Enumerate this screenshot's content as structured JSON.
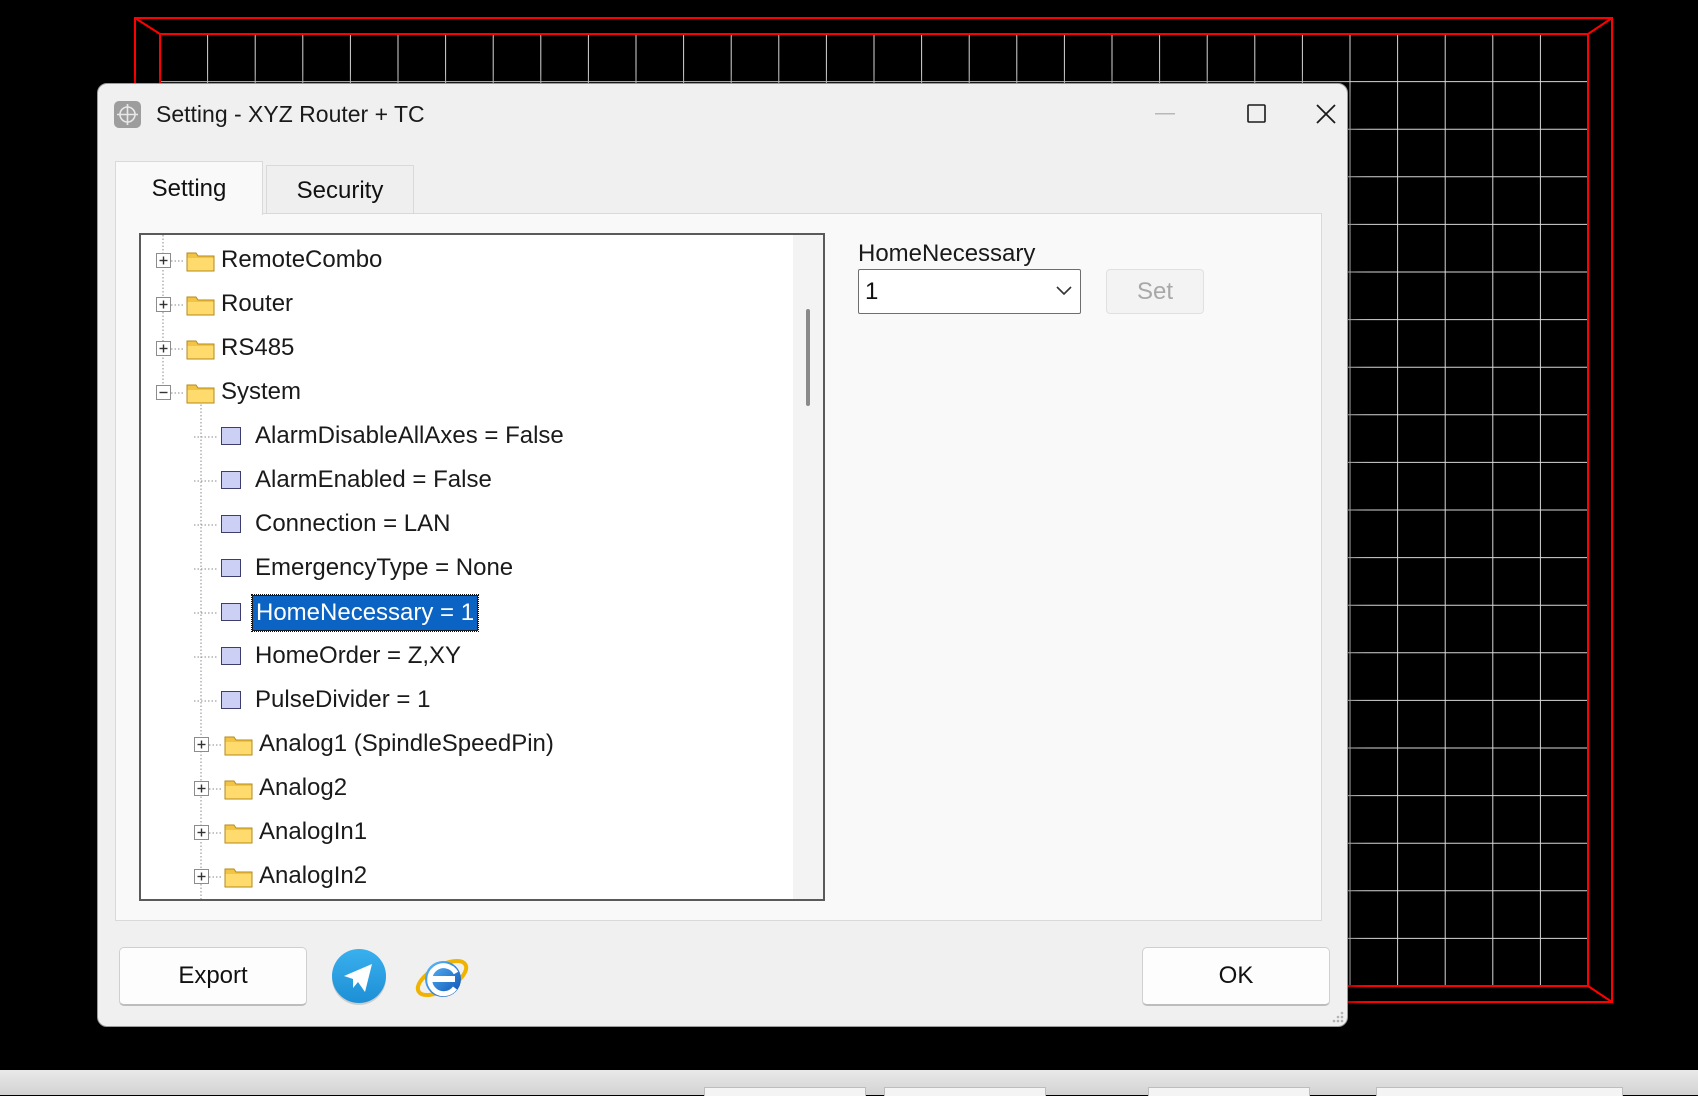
{
  "window": {
    "title": "Setting - XYZ Router + TC"
  },
  "tabs": [
    {
      "label": "Setting",
      "active": true
    },
    {
      "label": "Security",
      "active": false
    }
  ],
  "tree": {
    "nodes": [
      {
        "label": "RemoteCombo",
        "type": "folder",
        "expander": "plus"
      },
      {
        "label": "Router",
        "type": "folder",
        "expander": "plus"
      },
      {
        "label": "RS485",
        "type": "folder",
        "expander": "plus"
      },
      {
        "label": "System",
        "type": "folder",
        "expander": "minus"
      },
      {
        "label": "AlarmDisableAllAxes = False",
        "type": "leaf"
      },
      {
        "label": "AlarmEnabled = False",
        "type": "leaf"
      },
      {
        "label": "Connection = LAN",
        "type": "leaf"
      },
      {
        "label": "EmergencyType = None",
        "type": "leaf"
      },
      {
        "label": "HomeNecessary = 1",
        "type": "leaf",
        "selected": true
      },
      {
        "label": "HomeOrder = Z,XY",
        "type": "leaf"
      },
      {
        "label": "PulseDivider = 1",
        "type": "leaf"
      },
      {
        "label": "Analog1 (SpindleSpeedPin)",
        "type": "folder",
        "expander": "plus"
      },
      {
        "label": "Analog2",
        "type": "folder",
        "expander": "plus"
      },
      {
        "label": "AnalogIn1",
        "type": "folder",
        "expander": "plus"
      },
      {
        "label": "AnalogIn2",
        "type": "folder",
        "expander": "plus"
      }
    ]
  },
  "editor": {
    "property_label": "HomeNecessary",
    "value": "1",
    "set_label": "Set"
  },
  "footer": {
    "export_label": "Export",
    "ok_label": "OK"
  },
  "colors": {
    "selection": "#0b63c4",
    "grid_border": "#ff0000",
    "grid_lines": "#d8d8d8"
  }
}
